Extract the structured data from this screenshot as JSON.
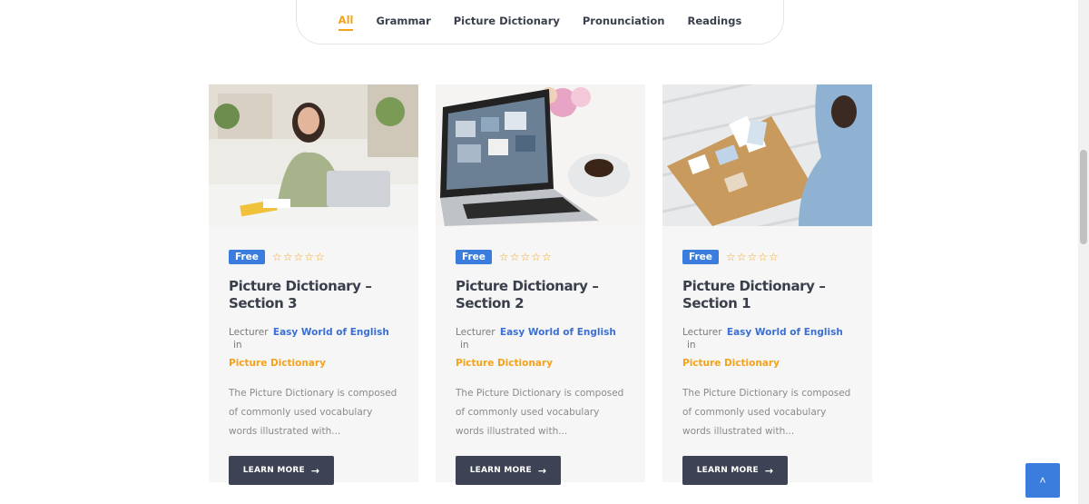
{
  "filters": {
    "tabs": [
      "All",
      "Grammar",
      "Picture Dictionary",
      "Pronunciation",
      "Readings"
    ],
    "active": "All"
  },
  "cards": [
    {
      "badge": "Free",
      "title": "Picture Dictionary – Section 3",
      "lecturer_prefix": "Lecturer",
      "lecturer": "Easy World of English",
      "in_word": "in",
      "category": "Picture Dictionary",
      "description": "The Picture Dictionary is composed of commonly used vocabulary words illustrated with...",
      "button": "LEARN MORE",
      "rating": 0
    },
    {
      "badge": "Free",
      "title": "Picture Dictionary – Section 2",
      "lecturer_prefix": "Lecturer",
      "lecturer": "Easy World of English",
      "in_word": "in",
      "category": "Picture Dictionary",
      "description": "The Picture Dictionary is composed of commonly used vocabulary words illustrated with...",
      "button": "LEARN MORE",
      "rating": 0
    },
    {
      "badge": "Free",
      "title": "Picture Dictionary – Section 1",
      "lecturer_prefix": "Lecturer",
      "lecturer": "Easy World of English",
      "in_word": "in",
      "category": "Picture Dictionary",
      "description": "The Picture Dictionary is composed of commonly used vocabulary words illustrated with...",
      "button": "LEARN MORE",
      "rating": 0
    }
  ],
  "icons": {
    "star": "star-outline-icon",
    "arrow": "arrow-right-icon",
    "to_top": "chevron-up-icon"
  },
  "colors": {
    "accent": "#f4a21b",
    "badge": "#3b7ddd",
    "button": "#3d4354",
    "link": "#3b6fd4"
  }
}
